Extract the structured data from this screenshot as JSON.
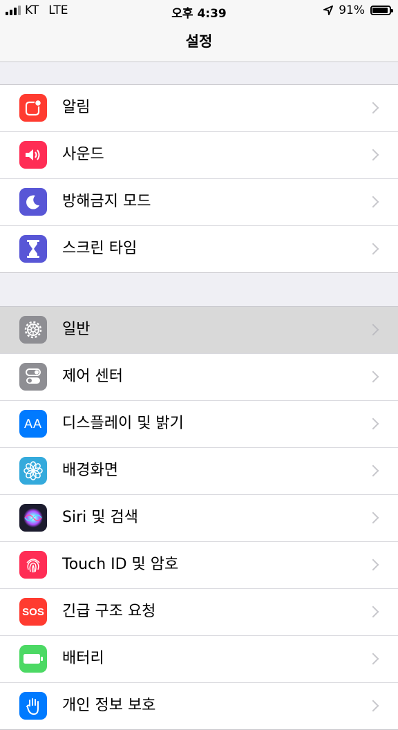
{
  "status_bar": {
    "carrier": "KT",
    "network": "LTE",
    "time": "오후 4:39",
    "battery": "91%"
  },
  "nav": {
    "title": "설정"
  },
  "group1": [
    {
      "label": "알림",
      "icon": "notifications-icon",
      "color": "#ff3b30"
    },
    {
      "label": "사운드",
      "icon": "sound-icon",
      "color": "#ff2d55"
    },
    {
      "label": "방해금지 모드",
      "icon": "moon-icon",
      "color": "#5856d6"
    },
    {
      "label": "스크린 타임",
      "icon": "hourglass-icon",
      "color": "#5856d6"
    }
  ],
  "group2": [
    {
      "label": "일반",
      "icon": "gear-icon",
      "color": "#8e8e93"
    },
    {
      "label": "제어 센터",
      "icon": "toggle-icon",
      "color": "#8e8e93"
    },
    {
      "label": "디스플레이 및 밝기",
      "icon": "text-size-icon",
      "color": "#007aff"
    },
    {
      "label": "배경화면",
      "icon": "flower-icon",
      "color": "#34aadc"
    },
    {
      "label": "Siri 및 검색",
      "icon": "siri-icon",
      "color": "#1c1c2e"
    },
    {
      "label": "Touch ID 및 암호",
      "icon": "fingerprint-icon",
      "color": "#ff2d55"
    },
    {
      "label": "긴급 구조 요청",
      "icon": "sos-icon",
      "color": "#ff3b30",
      "text": "SOS"
    },
    {
      "label": "배터리",
      "icon": "battery-icon",
      "color": "#4cd964"
    },
    {
      "label": "개인 정보 보호",
      "icon": "hand-icon",
      "color": "#007aff"
    }
  ],
  "icons_text": {
    "aa": "AA"
  }
}
